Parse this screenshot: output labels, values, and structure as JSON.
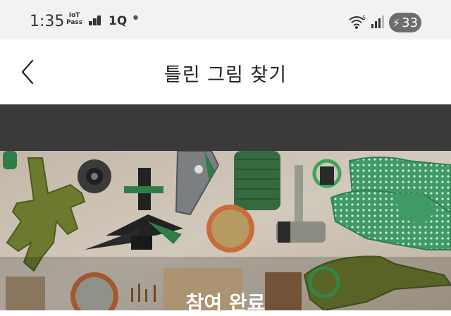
{
  "status_bar": {
    "time": "1:35",
    "iot_line1": "IoT",
    "iot_line2": "Pass",
    "carrier_tag": "1Q",
    "dot": "•",
    "wifi_badge": "5",
    "battery": "33"
  },
  "header": {
    "back_icon": "chevron-left-icon",
    "title": "틀린 그림 찾기"
  },
  "content": {
    "completion_label": "참여 완료"
  },
  "colors": {
    "status_bg": "#f2f2f2",
    "header_bg": "#ffffff",
    "dark_band": "#3a3a3a",
    "accent_green": "#3f8a52",
    "olive": "#6d7a2c"
  }
}
